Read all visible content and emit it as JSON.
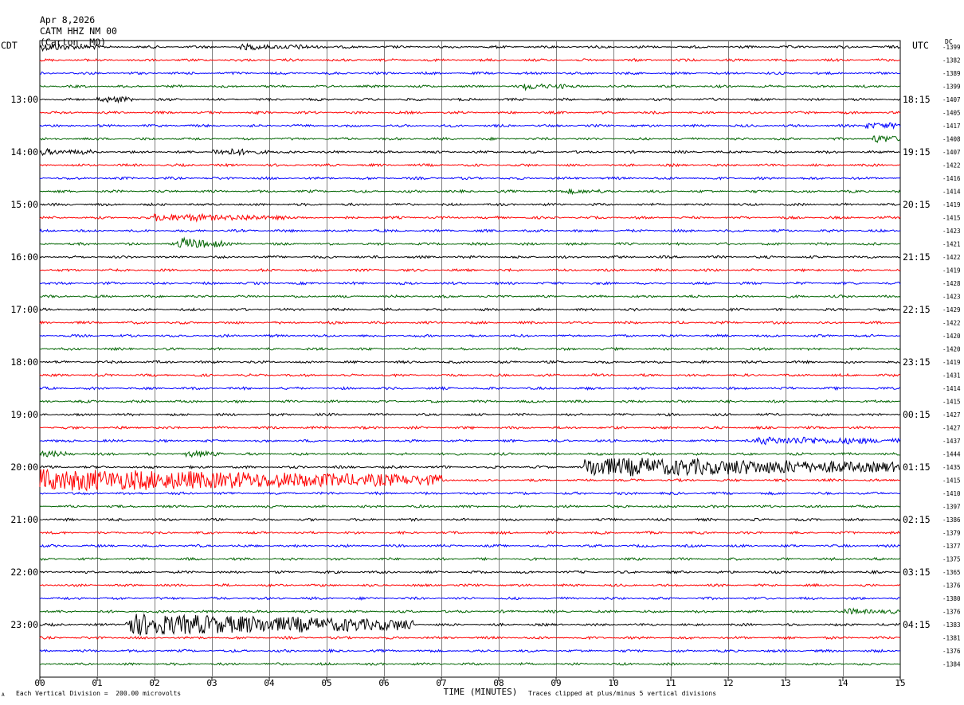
{
  "header": {
    "date": "Apr 8,2026",
    "station": "CATM HHZ NM 00",
    "location": "(Carton, MO)"
  },
  "left_zone_label": "CDT",
  "right_zone_label": "UTC",
  "dc_label": "DC",
  "footer": {
    "division_note": "Each Vertical Division =  200.00 microvolts",
    "clip_note": "Traces clipped at plus/minus 5 vertical divisions",
    "corner_mark": "A"
  },
  "colors": {
    "black": "#000000",
    "red": "#ff0000",
    "blue": "#0000ff",
    "green": "#006400",
    "grid": "#808080"
  },
  "chart_data": {
    "type": "line",
    "title": "Apr 8,2026  CATM HHZ NM 00  (Carton, MO)",
    "xlabel": "TIME (MINUTES)",
    "xlim": [
      0,
      15
    ],
    "x_ticks": [
      "00",
      "01",
      "02",
      "03",
      "04",
      "05",
      "06",
      "07",
      "08",
      "09",
      "10",
      "11",
      "12",
      "13",
      "14",
      "15"
    ],
    "left_time_labels": [
      "13:00",
      "14:00",
      "15:00",
      "16:00",
      "17:00",
      "18:00",
      "19:00",
      "20:00",
      "21:00",
      "22:00",
      "23:00"
    ],
    "right_time_labels": [
      "18:15",
      "19:15",
      "20:15",
      "21:15",
      "22:15",
      "23:15",
      "00:15",
      "01:15",
      "02:15",
      "03:15",
      "04:15"
    ],
    "trace_colors": [
      "black",
      "red",
      "blue",
      "green"
    ],
    "traces_per_hour": 4,
    "dc_offsets": [
      -1399,
      -1382,
      -1389,
      -1399,
      -1407,
      -1405,
      -1417,
      -1408,
      -1407,
      -1422,
      -1416,
      -1414,
      -1419,
      -1415,
      -1423,
      -1421,
      -1422,
      -1419,
      -1428,
      -1423,
      -1429,
      -1422,
      -1420,
      -1420,
      -1419,
      -1431,
      -1414,
      -1415,
      -1427,
      -1427,
      -1437,
      -1444,
      -1435,
      -1415,
      -1410,
      -1397,
      -1386,
      -1379,
      -1377,
      -1375,
      -1365,
      -1376,
      -1380,
      -1376,
      -1383,
      -1381,
      -1376,
      -1384
    ],
    "events": [
      {
        "trace": 0,
        "start_min": 0.0,
        "end_min": 1.0,
        "amp": 2.2
      },
      {
        "trace": 0,
        "start_min": 3.5,
        "end_min": 5.0,
        "amp": 1.4
      },
      {
        "trace": 3,
        "start_min": 8.4,
        "end_min": 9.2,
        "amp": 2.0
      },
      {
        "trace": 4,
        "start_min": 1.0,
        "end_min": 1.6,
        "amp": 2.0
      },
      {
        "trace": 6,
        "start_min": 14.4,
        "end_min": 15.0,
        "amp": 2.2
      },
      {
        "trace": 7,
        "start_min": 14.5,
        "end_min": 15.0,
        "amp": 2.5
      },
      {
        "trace": 8,
        "start_min": 0.0,
        "end_min": 0.9,
        "amp": 1.8
      },
      {
        "trace": 8,
        "start_min": 3.0,
        "end_min": 4.0,
        "amp": 2.0
      },
      {
        "trace": 11,
        "start_min": 9.2,
        "end_min": 9.8,
        "amp": 1.5
      },
      {
        "trace": 13,
        "start_min": 2.0,
        "end_min": 4.3,
        "amp": 2.3
      },
      {
        "trace": 15,
        "start_min": 2.4,
        "end_min": 3.2,
        "amp": 4.0
      },
      {
        "trace": 31,
        "start_min": 0.0,
        "end_min": 0.6,
        "amp": 1.5
      },
      {
        "trace": 31,
        "start_min": 2.5,
        "end_min": 3.2,
        "amp": 2.0
      },
      {
        "trace": 32,
        "start_min": 9.5,
        "end_min": 15.0,
        "amp": 7.0
      },
      {
        "trace": 33,
        "start_min": 0.0,
        "end_min": 7.0,
        "amp": 8.0
      },
      {
        "trace": 30,
        "start_min": 12.5,
        "end_min": 15.0,
        "amp": 2.5
      },
      {
        "trace": 44,
        "start_min": 1.5,
        "end_min": 6.5,
        "amp": 8.0
      },
      {
        "trace": 43,
        "start_min": 14.0,
        "end_min": 15.0,
        "amp": 1.5
      }
    ]
  }
}
